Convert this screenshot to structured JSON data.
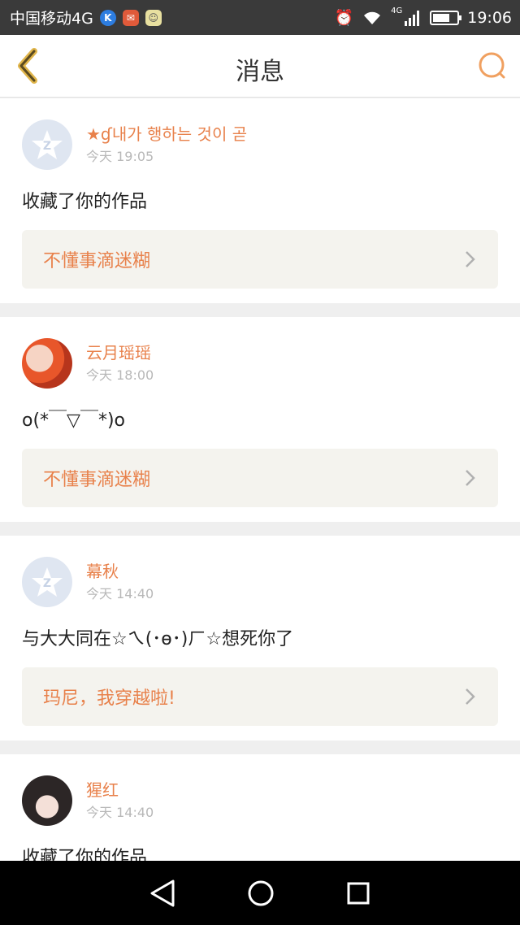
{
  "status_bar": {
    "carrier": "中国移动4G",
    "network": "4G",
    "time": "19:06"
  },
  "header": {
    "title": "消息"
  },
  "messages": [
    {
      "username": "★ɠ내가 행하는 것이 곧",
      "time": "今天 19:05",
      "text": "收藏了你的作品",
      "work_title": "不懂事滴迷糊",
      "avatar": "default"
    },
    {
      "username": "云月瑶瑶",
      "time": "今天 18:00",
      "text": "o(*￣▽￣*)o",
      "work_title": "不懂事滴迷糊",
      "avatar": "girl"
    },
    {
      "username": "幕秋",
      "time": "今天 14:40",
      "text": "与大大同在☆ㄟ(･ө･)ㄏ☆想死你了",
      "work_title": "玛尼，我穿越啦!",
      "avatar": "default"
    },
    {
      "username": "猩红",
      "time": "今天 14:40",
      "text": "收藏了你的作品",
      "work_title": "",
      "avatar": "boy"
    }
  ],
  "colors": {
    "accent": "#e8814b",
    "statusbar_bg": "#3a3a3a",
    "card_bg": "#ffffff",
    "work_bg": "#f4f3ee"
  },
  "icons": {
    "back": "back-chevron-icon",
    "search": "search-icon",
    "nav_back": "triangle-back-icon",
    "nav_home": "circle-home-icon",
    "nav_recent": "square-recent-icon"
  }
}
